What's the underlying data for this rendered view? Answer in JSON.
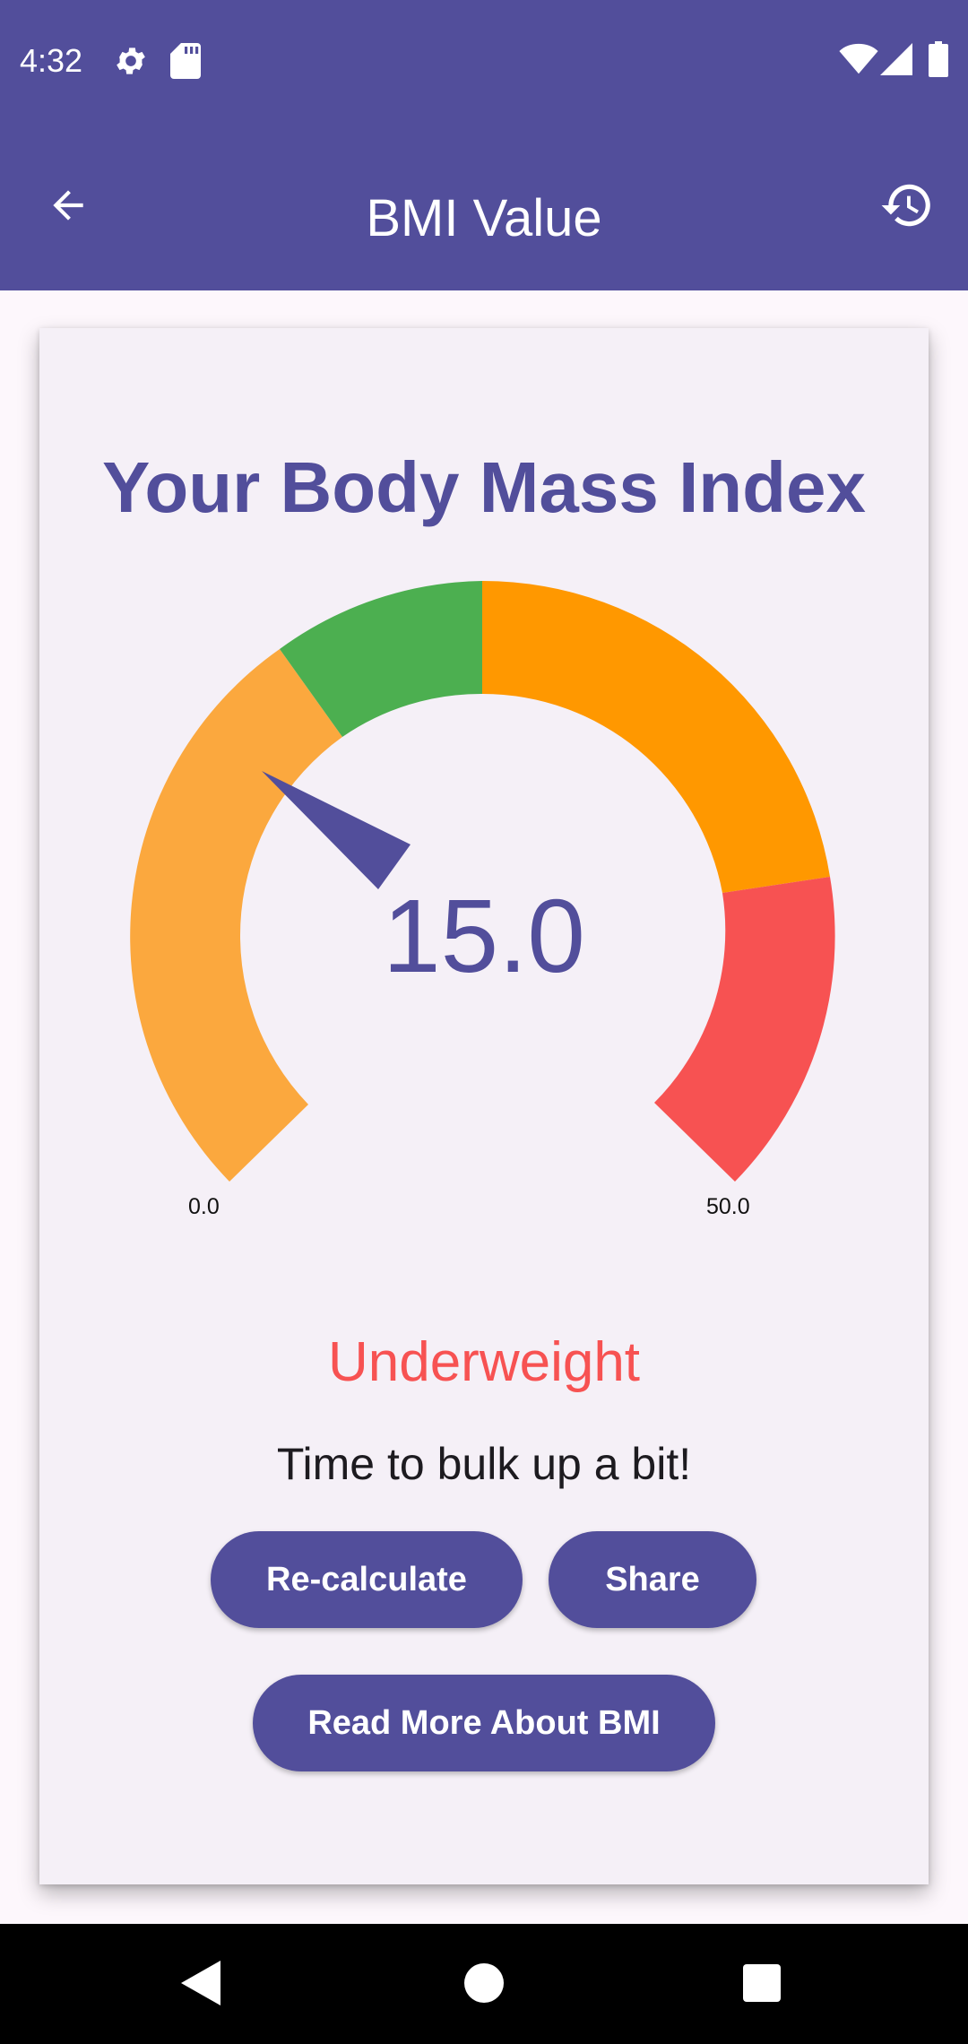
{
  "status_bar": {
    "time": "4:32",
    "icons": [
      "settings-icon",
      "sd-card-icon",
      "wifi-icon",
      "signal-icon",
      "battery-icon"
    ]
  },
  "app_bar": {
    "title": "BMI Value",
    "back_icon": "arrow-back-icon",
    "history_icon": "history-icon",
    "background": "#524e9b"
  },
  "card": {
    "title": "Your Body Mass Index",
    "gauge": {
      "value_text": "15.0",
      "value": 15.0,
      "min_label": "0.0",
      "max_label": "50.0",
      "min": 0,
      "max": 50,
      "segment_colors": [
        "#fba83e",
        "#4caf50",
        "#ff9800",
        "#f75252"
      ]
    },
    "category": "Underweight",
    "category_color": "#f75252",
    "message": "Time to bulk up a bit!",
    "buttons": {
      "recalculate": "Re-calculate",
      "share": "Share",
      "read_more": "Read More About BMI"
    }
  },
  "nav_bar": {
    "icons": [
      "back-triangle-icon",
      "home-circle-icon",
      "recents-square-icon"
    ]
  }
}
